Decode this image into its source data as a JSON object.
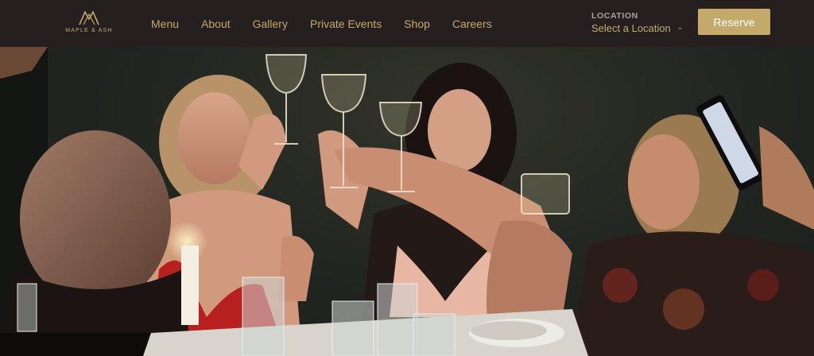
{
  "header": {
    "logo_text": "MAPLE & ASH",
    "nav": [
      {
        "label": "Menu"
      },
      {
        "label": "About"
      },
      {
        "label": "Gallery"
      },
      {
        "label": "Private Events"
      },
      {
        "label": "Shop"
      },
      {
        "label": "Careers"
      }
    ],
    "location": {
      "label": "LOCATION",
      "value": "Select a Location",
      "icon": "chevron-down-icon"
    },
    "reserve_label": "Reserve"
  },
  "hero": {
    "description_icon": "hero-photo"
  },
  "colors": {
    "header_bg": "#261f20",
    "accent_gold": "#c3a96a",
    "label_gray": "#a7a3a1",
    "button_text": "#ffffff"
  }
}
